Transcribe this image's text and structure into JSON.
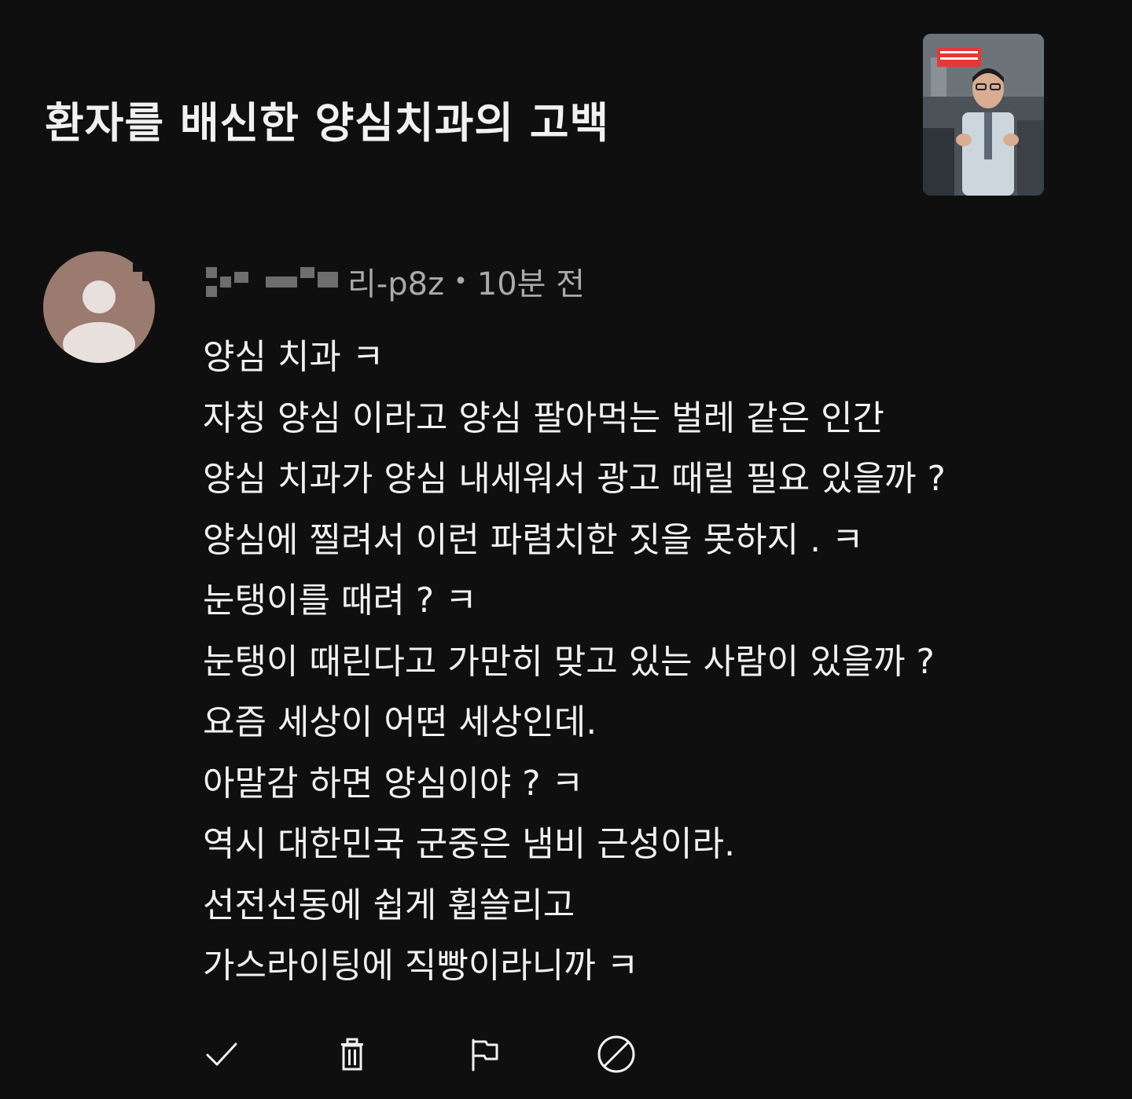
{
  "video": {
    "title": "환자를 배신한 양심치과의 고백",
    "thumbnail": {
      "description_icon": "video-thumbnail",
      "accent_color": "#e53935"
    }
  },
  "comment": {
    "author_visible": "리-p8z",
    "separator": "•",
    "timestamp": "10분 전",
    "lines": [
      "양심 치과 ㅋ",
      "자칭 양심 이라고 양심 팔아먹는 벌레 같은 인간",
      "양심 치과가 양심 내세워서 광고 때릴 필요 있을까 ?",
      "양심에 찔려서 이런 파렴치한 짓을 못하지 . ㅋ",
      "눈탱이를 때려  ? ㅋ",
      "눈탱이 때린다고 가만히 맞고 있는 사람이 있을까 ?",
      "요즘 세상이 어떤 세상인데.",
      "아말감 하면 양심이야 ? ㅋ",
      "역시 대한민국 군중은 냄비 근성이라.",
      "선전선동에 쉽게 휩쓸리고",
      "가스라이팅에 직빵이라니까 ㅋ"
    ]
  },
  "actions": [
    {
      "name": "approve-button",
      "icon": "check-icon"
    },
    {
      "name": "delete-button",
      "icon": "trash-icon"
    },
    {
      "name": "report-button",
      "icon": "flag-icon"
    },
    {
      "name": "block-button",
      "icon": "block-icon"
    }
  ],
  "colors": {
    "background": "#0f0f0f",
    "text_primary": "#f1f1f1",
    "text_secondary": "#aaaaaa",
    "avatar_bg": "#9b7a70",
    "avatar_fg": "#e8e0dd"
  }
}
